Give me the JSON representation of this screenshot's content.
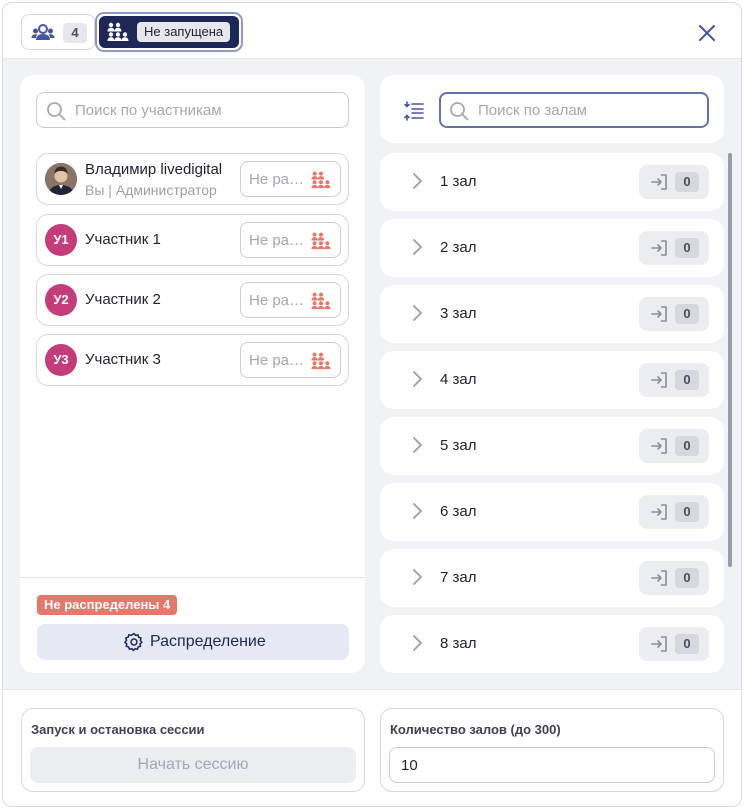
{
  "header": {
    "participants_icon": "people-icon",
    "participants_count": "4",
    "status_icon": "breakout-rooms-icon",
    "status_label": "Не запущена",
    "close_icon": "close-icon"
  },
  "participants": {
    "search_placeholder": "Поиск по участникам",
    "list": [
      {
        "avatar": "photo",
        "initials": "",
        "name": "Владимир livedigital",
        "role": "Вы | Администратор",
        "assign_label": "Не распределен"
      },
      {
        "avatar": "initials",
        "initials": "У1",
        "name": "Участник 1",
        "role": "",
        "assign_label": "Не распределен"
      },
      {
        "avatar": "initials",
        "initials": "У2",
        "name": "Участник 2",
        "role": "",
        "assign_label": "Не распределен"
      },
      {
        "avatar": "initials",
        "initials": "У3",
        "name": "Участник 3",
        "role": "",
        "assign_label": "Не распределен"
      }
    ],
    "unassigned_badge": "Не распределены 4",
    "distribute_label": "Распределение"
  },
  "rooms": {
    "search_placeholder": "Поиск по залам",
    "sort_icon": "sort-icon",
    "list": [
      {
        "name": "1 зал",
        "count": "0"
      },
      {
        "name": "2 зал",
        "count": "0"
      },
      {
        "name": "3 зал",
        "count": "0"
      },
      {
        "name": "4 зал",
        "count": "0"
      },
      {
        "name": "5 зал",
        "count": "0"
      },
      {
        "name": "6 зал",
        "count": "0"
      },
      {
        "name": "7 зал",
        "count": "0"
      },
      {
        "name": "8 зал",
        "count": "0"
      }
    ]
  },
  "session": {
    "title": "Запуск и остановка сессии",
    "start_label": "Начать сессию"
  },
  "room_count": {
    "title": "Количество залов (до 300)",
    "value": "10"
  },
  "colors": {
    "accent_dark": "#1f2756",
    "accent_border": "#8f97c9",
    "unassigned": "#e8766a",
    "avatar": "#c43c7a"
  }
}
